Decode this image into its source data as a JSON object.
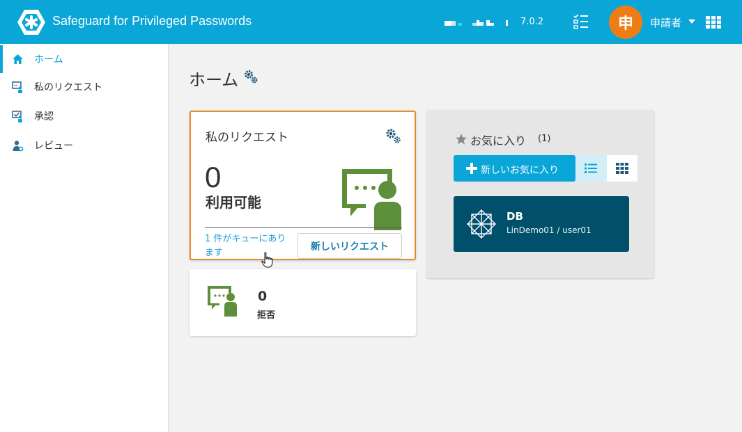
{
  "header": {
    "app_title": "Safeguard for Privileged Passwords",
    "version": "7.0.2",
    "avatar_char": "申",
    "user_name": "申請者"
  },
  "sidebar": {
    "items": [
      {
        "label": "ホーム",
        "icon": "home-icon",
        "active": true
      },
      {
        "label": "私のリクエスト",
        "icon": "my-requests-icon",
        "active": false
      },
      {
        "label": "承認",
        "icon": "approvals-icon",
        "active": false
      },
      {
        "label": "レビュー",
        "icon": "reviews-icon",
        "active": false
      }
    ]
  },
  "main": {
    "page_title": "ホーム",
    "my_requests": {
      "title": "私のリクエスト",
      "count": "0",
      "status": "利用可能",
      "queued_text": "1 件がキューにあります",
      "new_request_label": "新しいリクエスト"
    },
    "denied": {
      "count": "0",
      "label": "拒否"
    },
    "favorites": {
      "title": "お気に入り",
      "count": "(1)",
      "new_favorite_label": "新しいお気に入り",
      "items": [
        {
          "name": "DB",
          "detail": "LinDemo01 / user01"
        }
      ]
    }
  },
  "colors": {
    "header": "#0aa6d8",
    "accent": "#0aa6d8",
    "avatar": "#f07d14",
    "card_highlight": "#e8892e",
    "illustration_green": "#5e8f3a",
    "favorite_tile": "#004f6b"
  }
}
